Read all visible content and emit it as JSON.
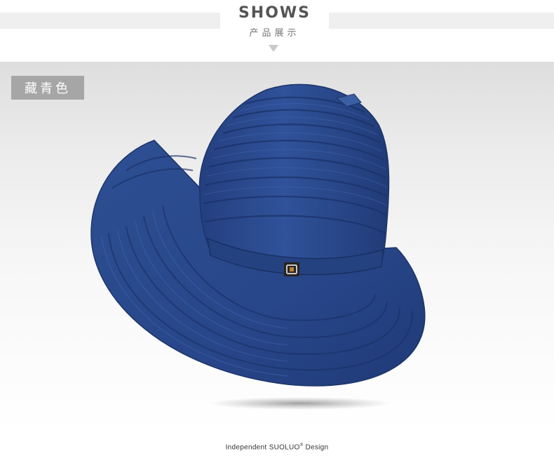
{
  "header": {
    "title": "SHOWS",
    "subtitle": "产品展示"
  },
  "product": {
    "color_label": "藏青色",
    "hat_color": "#2b4a8c",
    "hat_image_icon": "navy-bucket-hat-image"
  },
  "footer": {
    "prefix": "Independent",
    "brand": "SUOLUO",
    "brand_mark": "®",
    "suffix": "Design"
  }
}
